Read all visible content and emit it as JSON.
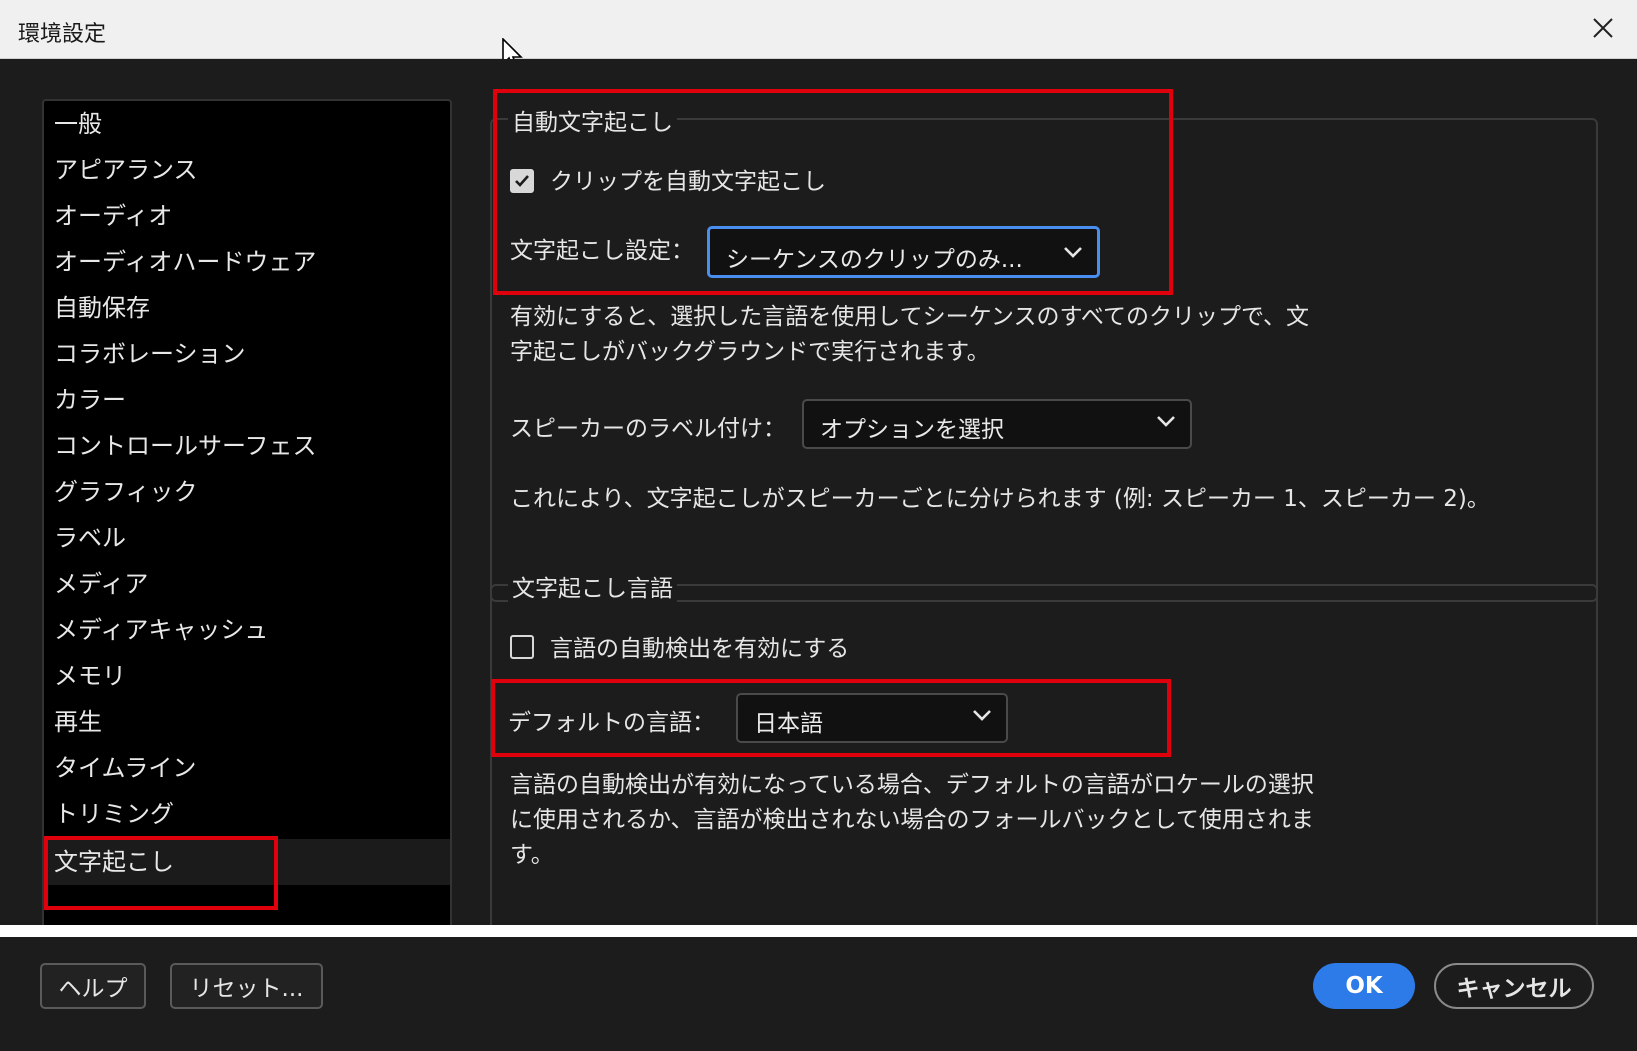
{
  "window": {
    "title": "環境設定"
  },
  "sidebar": {
    "items": [
      {
        "label": "一般"
      },
      {
        "label": "アピアランス"
      },
      {
        "label": "オーディオ"
      },
      {
        "label": "オーディオハードウェア"
      },
      {
        "label": "自動保存"
      },
      {
        "label": "コラボレーション"
      },
      {
        "label": "カラー"
      },
      {
        "label": "コントロールサーフェス"
      },
      {
        "label": "グラフィック"
      },
      {
        "label": "ラベル"
      },
      {
        "label": "メディア"
      },
      {
        "label": "メディアキャッシュ"
      },
      {
        "label": "メモリ"
      },
      {
        "label": "再生"
      },
      {
        "label": "タイムライン"
      },
      {
        "label": "トリミング"
      },
      {
        "label": "文字起こし"
      }
    ],
    "selected_label": "文字起こし"
  },
  "auto_transcription": {
    "group_title": "自動文字起こし",
    "checkbox_label": "クリップを自動文字起こし",
    "checkbox_checked": true,
    "setting_label": "文字起こし設定：",
    "setting_value": "シーケンスのクリップのみ...",
    "description_line1": "有効にすると、選択した言語を使用してシーケンスのすべてのクリップで、文",
    "description_line2": "字起こしがバックグラウンドで実行されます。",
    "speaker_label": "スピーカーのラベル付け：",
    "speaker_value": "オプションを選択",
    "speaker_description": "これにより、文字起こしがスピーカーごとに分けられます (例: スピーカー 1、スピーカー 2)。"
  },
  "language": {
    "group_title": "文字起こし言語",
    "autodetect_label": "言語の自動検出を有効にする",
    "autodetect_checked": false,
    "default_label": "デフォルトの言語：",
    "default_value": "日本語",
    "description_line1": "言語の自動検出が有効になっている場合、デフォルトの言語がロケールの選択",
    "description_line2": "に使用されるか、言語が検出されない場合のフォールバックとして使用されま",
    "description_line3": "す。"
  },
  "footer": {
    "help_label": "ヘルプ",
    "reset_label": "リセット...",
    "ok_label": "OK",
    "cancel_label": "キャンセル"
  },
  "colors": {
    "accent": "#2d7be8",
    "highlight_box": "#e0000c",
    "focus_ring": "#4a8ef0",
    "background": "#1c1c1c"
  }
}
